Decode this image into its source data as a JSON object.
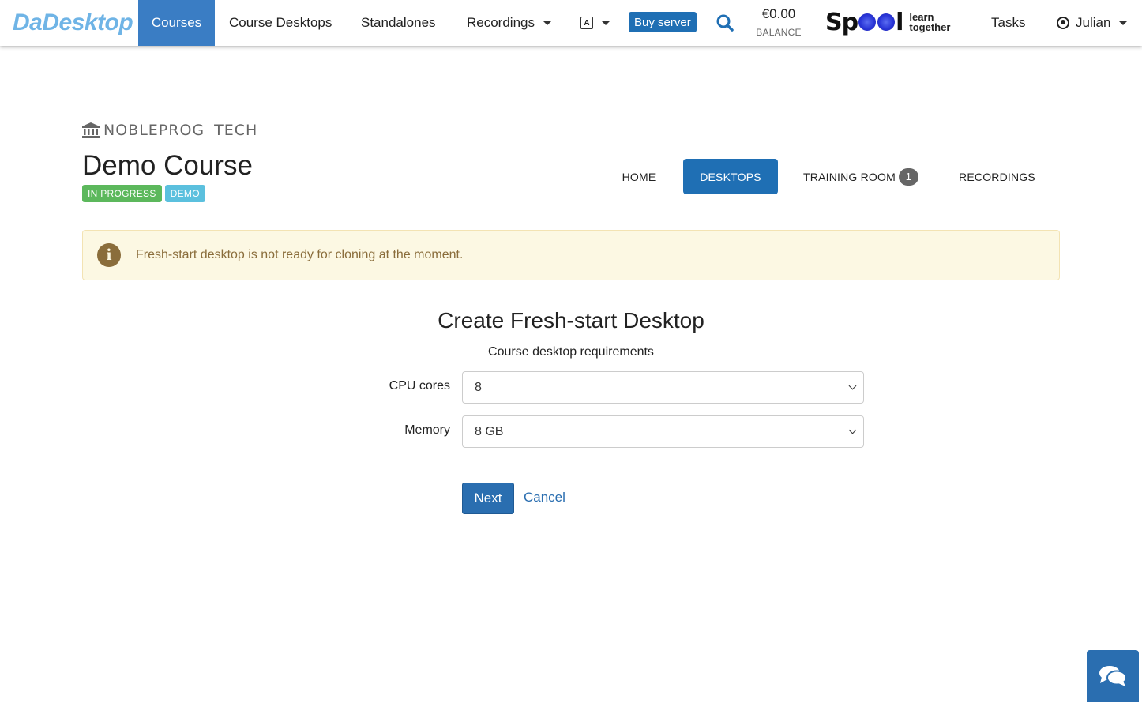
{
  "navbar": {
    "brand": "DaDesktop",
    "items": {
      "courses": "Courses",
      "course_desktops": "Course Desktops",
      "standalones": "Standalones",
      "recordings": "Recordings"
    },
    "lang_icon": "translate-icon",
    "buy_server": "Buy server",
    "balance_amount": "€0.00",
    "balance_label": "BALANCE",
    "spool": {
      "word_start": "Sp",
      "word_end": "l",
      "tagline_line1": "learn",
      "tagline_line2": "together"
    },
    "tasks": "Tasks",
    "user": "Julian"
  },
  "header": {
    "org_name_1": "NOBLEPROG",
    "org_name_2": "TECH",
    "course_title": "Demo Course",
    "badges": {
      "status": "IN PROGRESS",
      "type": "DEMO"
    },
    "tabs": {
      "home": "HOME",
      "desktops": "DESKTOPS",
      "training_room": "TRAINING ROOM",
      "training_room_count": "1",
      "recordings": "RECORDINGS"
    }
  },
  "alert": {
    "icon": "info-icon",
    "text": "Fresh-start desktop is not ready for cloning at the moment."
  },
  "form": {
    "title": "Create Fresh-start Desktop",
    "subtitle": "Course desktop requirements",
    "cpu_label": "CPU cores",
    "cpu_value": "8",
    "memory_label": "Memory",
    "memory_value": "8 GB",
    "next_label": "Next",
    "cancel_label": "Cancel"
  },
  "colors": {
    "primary": "#1f6fb4",
    "nav_active": "#3a7dc4",
    "brand": "#6fb4e6",
    "badge_green": "#5cb85c",
    "badge_blue": "#5bc0de",
    "alert_bg": "#fcf8e3",
    "alert_text": "#8a6d3b"
  }
}
